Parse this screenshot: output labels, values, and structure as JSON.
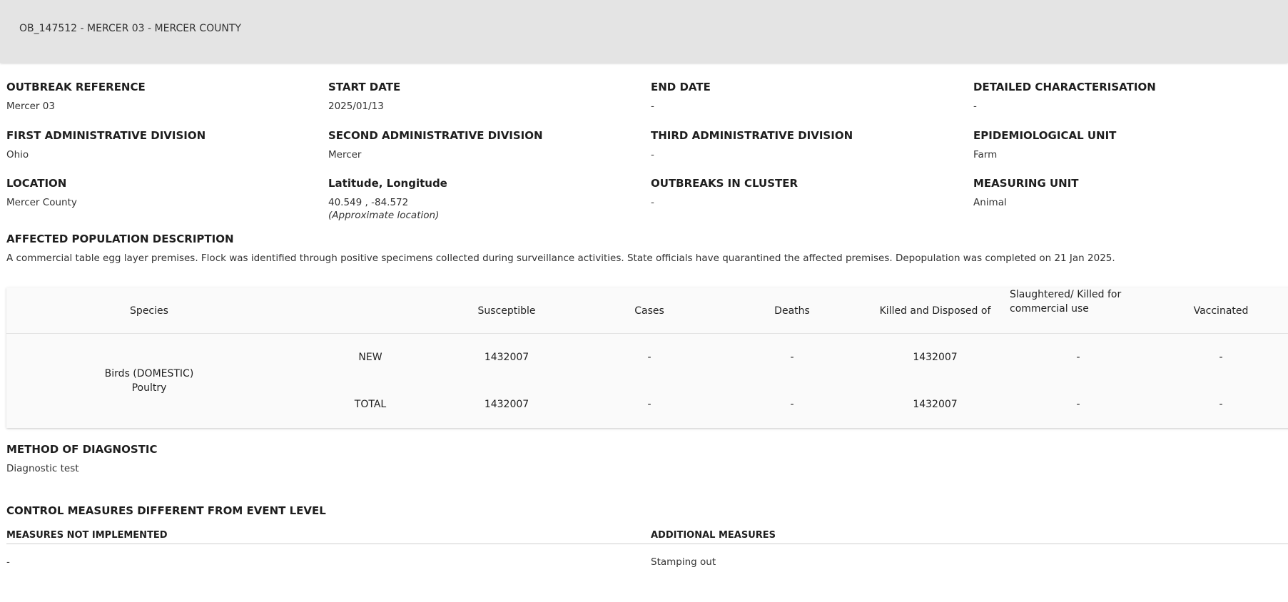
{
  "header": {
    "title": "OB_147512 - MERCER 03 - MERCER COUNTY"
  },
  "fields": {
    "outbreak_reference": {
      "label": "OUTBREAK REFERENCE",
      "value": "Mercer 03"
    },
    "start_date": {
      "label": "START DATE",
      "value": "2025/01/13"
    },
    "end_date": {
      "label": "END DATE",
      "value": "-"
    },
    "detailed_characterisation": {
      "label": "DETAILED CHARACTERISATION",
      "value": "-"
    },
    "first_admin_division": {
      "label": "FIRST ADMINISTRATIVE DIVISION",
      "value": "Ohio"
    },
    "second_admin_division": {
      "label": "SECOND ADMINISTRATIVE DIVISION",
      "value": "Mercer"
    },
    "third_admin_division": {
      "label": "THIRD ADMINISTRATIVE DIVISION",
      "value": "-"
    },
    "epidemiological_unit": {
      "label": "EPIDEMIOLOGICAL UNIT",
      "value": "Farm"
    },
    "location": {
      "label": "LOCATION",
      "value": "Mercer County"
    },
    "lat_long": {
      "label": "Latitude, Longitude",
      "value": "40.549 , -84.572",
      "note": "(Approximate location)"
    },
    "outbreaks_in_cluster": {
      "label": "OUTBREAKS IN CLUSTER",
      "value": "-"
    },
    "measuring_unit": {
      "label": "MEASURING UNIT",
      "value": "Animal"
    }
  },
  "affected_population": {
    "label": "AFFECTED POPULATION DESCRIPTION",
    "value": "A commercial table egg layer premises. Flock was identified through positive specimens collected during surveillance activities. State officials have quarantined the affected premises. Depopulation was completed on 21 Jan 2025."
  },
  "table": {
    "headers": {
      "species": "Species",
      "susceptible": "Susceptible",
      "cases": "Cases",
      "deaths": "Deaths",
      "killed": "Killed and Disposed of",
      "slaughtered_line1": "Slaughtered/ Killed for",
      "slaughtered_line2": "commercial use",
      "vaccinated": "Vaccinated"
    },
    "species_line1": "Birds (DOMESTIC)",
    "species_line2": "Poultry",
    "rows": [
      {
        "type": "NEW",
        "susceptible": "1432007",
        "cases": "-",
        "deaths": "-",
        "killed": "1432007",
        "slaughtered": "-",
        "vaccinated": "-"
      },
      {
        "type": "TOTAL",
        "susceptible": "1432007",
        "cases": "-",
        "deaths": "-",
        "killed": "1432007",
        "slaughtered": "-",
        "vaccinated": "-"
      }
    ]
  },
  "diagnostic": {
    "label": "METHOD OF DIAGNOSTIC",
    "value": "Diagnostic test"
  },
  "control_measures": {
    "label": "CONTROL MEASURES DIFFERENT FROM EVENT LEVEL",
    "not_implemented": {
      "label": "MEASURES NOT IMPLEMENTED",
      "value": "-"
    },
    "additional": {
      "label": "ADDITIONAL MEASURES",
      "value": "Stamping out"
    }
  }
}
